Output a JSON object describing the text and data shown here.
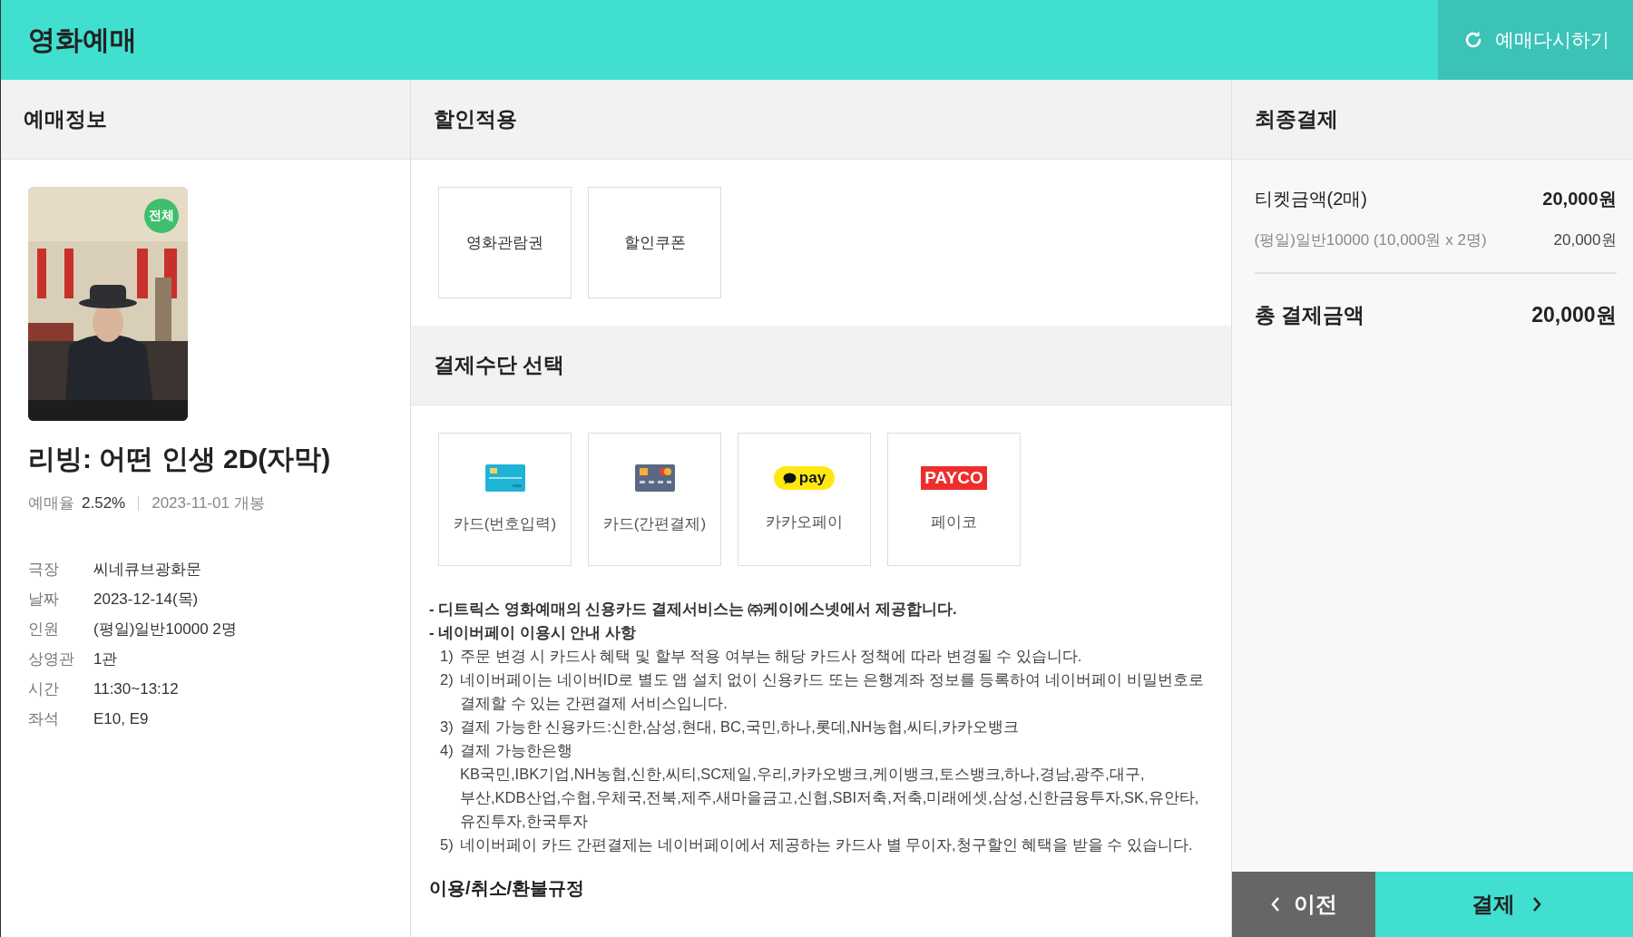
{
  "header": {
    "title": "영화예매",
    "restart_button": "예매다시하기"
  },
  "booking_info": {
    "heading": "예매정보",
    "rating_badge": "전체",
    "movie_title": "리빙: 어떤 인생 2D(자막)",
    "rate_label": "예매율",
    "rate_value": "2.52%",
    "release": "2023-11-01 개봉",
    "details": [
      {
        "label": "극장",
        "value": "씨네큐브광화문"
      },
      {
        "label": "날짜",
        "value": "2023-12-14(목)"
      },
      {
        "label": "인원",
        "value": "(평일)일반10000 2명"
      },
      {
        "label": "상영관",
        "value": "1관"
      },
      {
        "label": "시간",
        "value": "11:30~13:12"
      },
      {
        "label": "좌석",
        "value": "E10, E9"
      }
    ]
  },
  "discount": {
    "heading": "할인적용",
    "options": [
      "영화관람권",
      "할인쿠폰"
    ]
  },
  "payment": {
    "heading": "결제수단 선택",
    "methods": [
      {
        "kind": "card",
        "label": "카드(번호입력)"
      },
      {
        "kind": "easy_card",
        "label": "카드(간편결제)"
      },
      {
        "kind": "kakaopay",
        "logo": "pay",
        "label": "카카오페이"
      },
      {
        "kind": "payco",
        "logo": "PAYCO",
        "label": "페이코"
      }
    ],
    "notes": [
      {
        "kind": "bullet",
        "text": "- 디트릭스 영화예매의 신용카드 결제서비스는 ㈜케이에스넷에서 제공합니다."
      },
      {
        "kind": "bullet",
        "text": "- 네이버페이 이용시 안내 사항"
      },
      {
        "kind": "numbered",
        "number": "1)",
        "lines": [
          "주문 변경 시 카드사 혜택 및 할부 적용 여부는 해당 카드사 정책에 따라 변경될 수 있습니다."
        ]
      },
      {
        "kind": "numbered",
        "number": "2)",
        "lines": [
          "네이버페이는 네이버ID로 별도 앱 설치 없이 신용카드 또는 은행계좌 정보를 등록하여 네이버페이 비밀번호로",
          "결제할 수 있는 간편결제 서비스입니다."
        ]
      },
      {
        "kind": "numbered",
        "number": "3)",
        "lines": [
          "결제 가능한 신용카드:신한,삼성,현대, BC,국민,하나,롯데,NH농협,씨티,카카오뱅크"
        ]
      },
      {
        "kind": "numbered",
        "number": "4)",
        "lines": [
          "결제 가능한은행",
          "KB국민,IBK기업,NH농협,신한,씨티,SC제일,우리,카카오뱅크,케이뱅크,토스뱅크,하나,경남,광주,대구,",
          "부산,KDB산업,수협,우체국,전북,제주,새마을금고,신협,SBI저축,저축,미래에셋,삼성,신한금융투자,SK,유안타,",
          "유진투자,한국투자"
        ]
      },
      {
        "kind": "numbered",
        "number": "5)",
        "lines": [
          "네이버페이 카드 간편결제는 네이버페이에서 제공하는 카드사 별 무이자,청구할인 혜택을 받을 수 있습니다."
        ]
      }
    ],
    "policy_heading": "이용/취소/환불규정"
  },
  "summary": {
    "heading": "최종결제",
    "ticket_label": "티켓금액(2매)",
    "ticket_amount": "20,000원",
    "line_label": "(평일)일반10000 (10,000원 x 2명)",
    "line_amount": "20,000원",
    "total_label": "총 결제금액",
    "total_amount": "20,000원"
  },
  "footer": {
    "prev_button": "이전",
    "pay_button": "결제"
  }
}
